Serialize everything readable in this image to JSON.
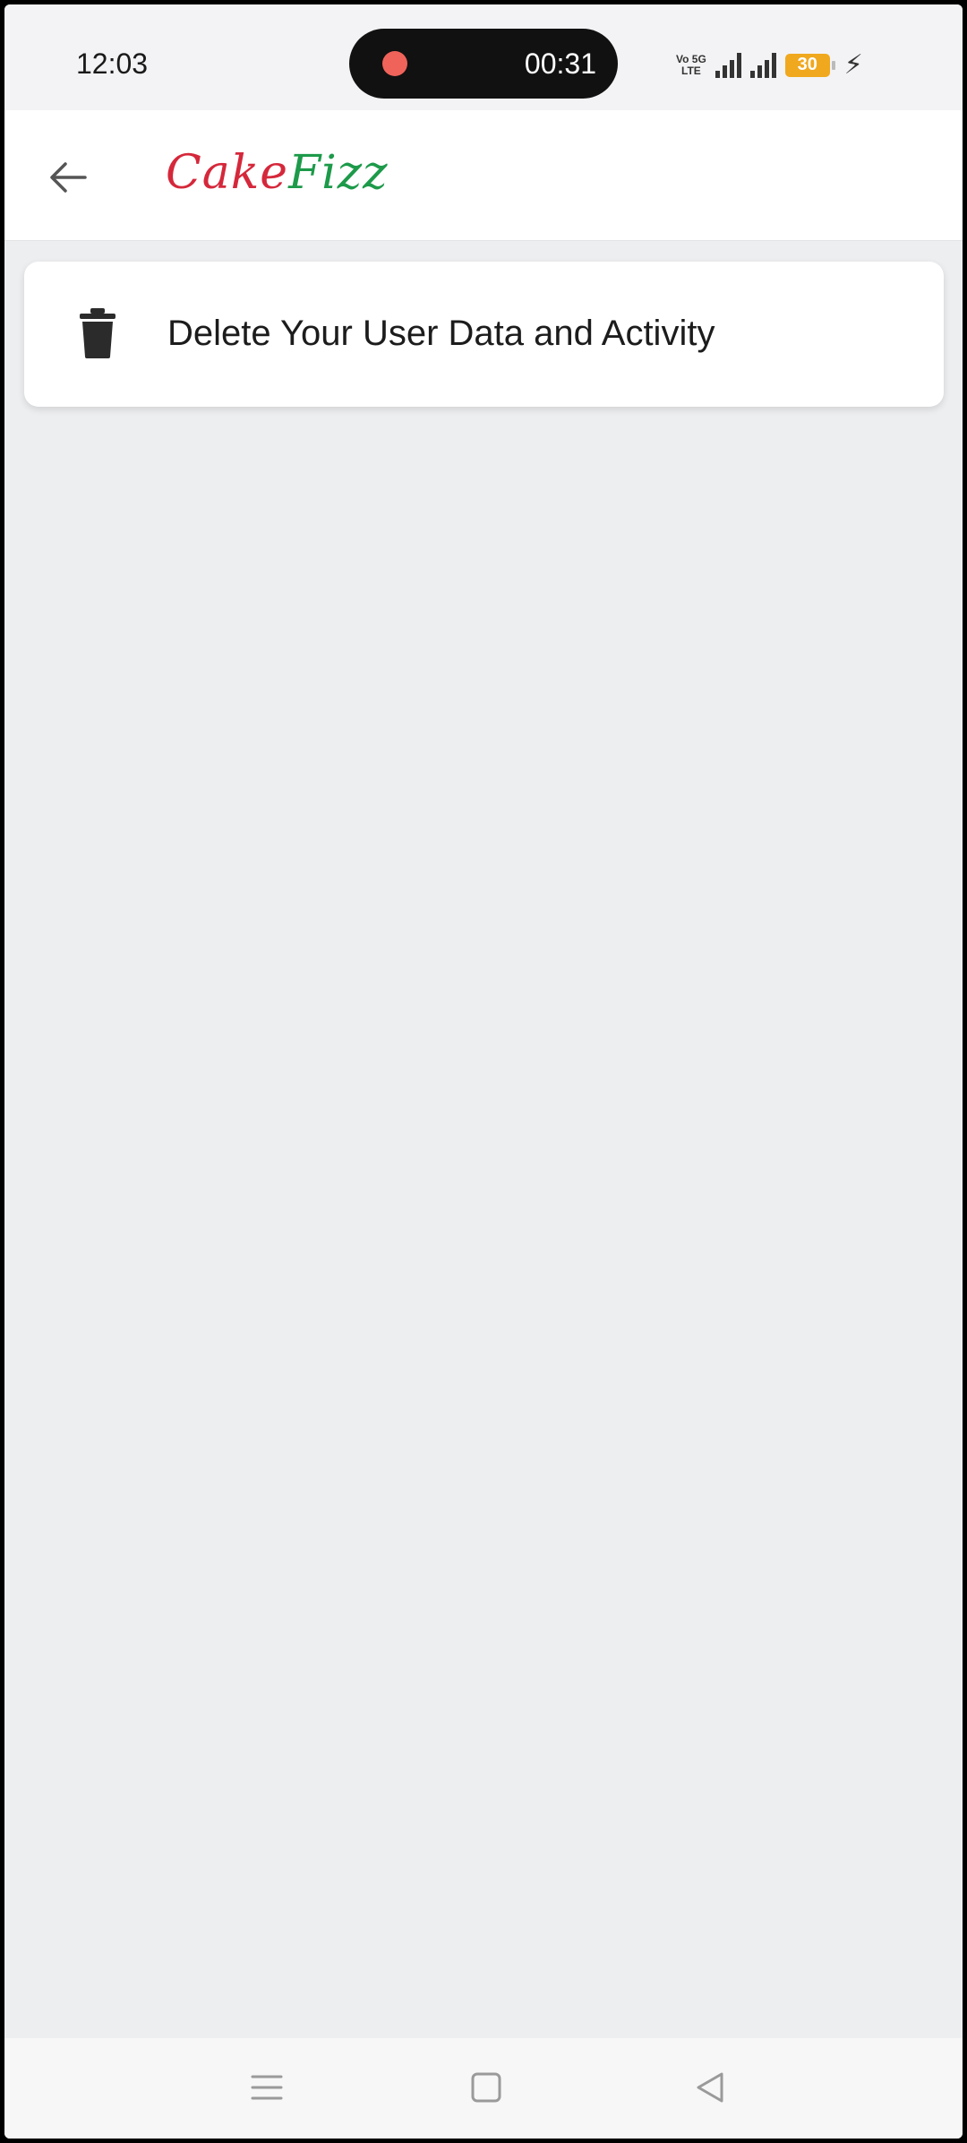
{
  "status_bar": {
    "time": "12:03",
    "recording_time": "00:31",
    "network_line1": "Vo 5G",
    "network_line2": "LTE",
    "battery": "30"
  },
  "app_bar": {
    "logo_part1": "Cake",
    "logo_part2": "Fizz"
  },
  "card": {
    "label": "Delete Your User Data and Activity"
  },
  "colors": {
    "logo_red": "#d5283b",
    "logo_green": "#1d9a4a",
    "battery": "#f0a81e",
    "record_dot": "#f0635a",
    "background": "#edeef0"
  },
  "icons": {
    "back": "arrow-left-icon",
    "delete": "trash-icon",
    "recents": "menu-lines-icon",
    "home": "square-icon",
    "navigate_back": "triangle-back-icon"
  }
}
